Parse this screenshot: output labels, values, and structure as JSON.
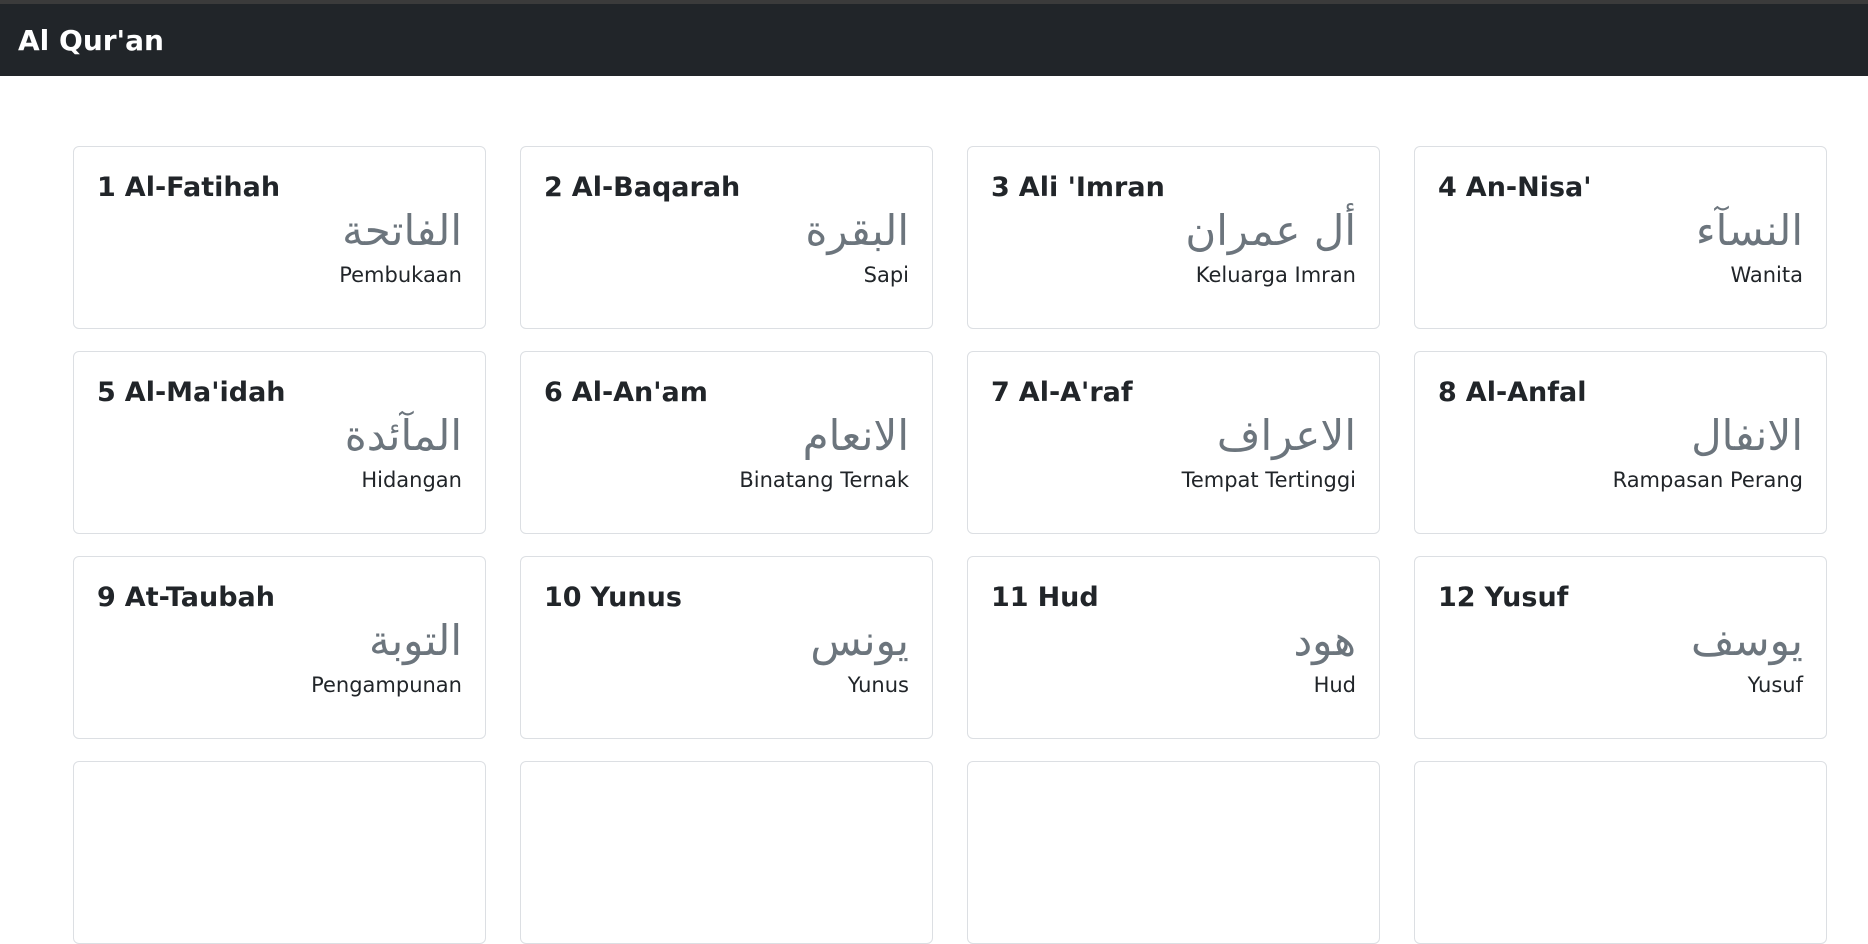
{
  "navbar": {
    "brand": "Al Qur'an"
  },
  "surahs": [
    {
      "number": "1",
      "name": "Al-Fatihah",
      "arabic": "الفاتحة",
      "meaning": "Pembukaan"
    },
    {
      "number": "2",
      "name": "Al-Baqarah",
      "arabic": "البقرة",
      "meaning": "Sapi"
    },
    {
      "number": "3",
      "name": "Ali 'Imran",
      "arabic": "أل عمران",
      "meaning": "Keluarga Imran"
    },
    {
      "number": "4",
      "name": "An-Nisa'",
      "arabic": "النسآء",
      "meaning": "Wanita"
    },
    {
      "number": "5",
      "name": "Al-Ma'idah",
      "arabic": "المآئدة",
      "meaning": "Hidangan"
    },
    {
      "number": "6",
      "name": "Al-An'am",
      "arabic": "الانعام",
      "meaning": "Binatang Ternak"
    },
    {
      "number": "7",
      "name": "Al-A'raf",
      "arabic": "الاعراف",
      "meaning": "Tempat Tertinggi"
    },
    {
      "number": "8",
      "name": "Al-Anfal",
      "arabic": "الانفال",
      "meaning": "Rampasan Perang"
    },
    {
      "number": "9",
      "name": "At-Taubah",
      "arabic": "التوبة",
      "meaning": "Pengampunan"
    },
    {
      "number": "10",
      "name": "Yunus",
      "arabic": "يونس",
      "meaning": "Yunus"
    },
    {
      "number": "11",
      "name": "Hud",
      "arabic": "هود",
      "meaning": "Hud"
    },
    {
      "number": "12",
      "name": "Yusuf",
      "arabic": "يوسف",
      "meaning": "Yusuf"
    },
    {
      "number": "",
      "name": "",
      "arabic": "",
      "meaning": ""
    },
    {
      "number": "",
      "name": "",
      "arabic": "",
      "meaning": ""
    },
    {
      "number": "",
      "name": "",
      "arabic": "",
      "meaning": ""
    },
    {
      "number": "",
      "name": "",
      "arabic": "",
      "meaning": ""
    }
  ]
}
